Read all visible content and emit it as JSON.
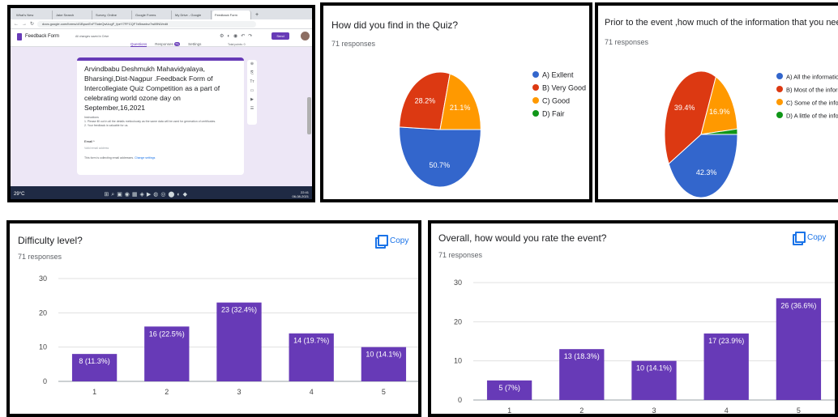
{
  "screenshot": {
    "tabs": [
      "What's New",
      "Jake Search",
      "Survey, Online",
      "Google Forms",
      "My Drive - Google",
      "Feedback Form"
    ],
    "url": "docs.google.com/forms/d/1BpunEvFTkdeQwUugF_fpeY7FFCQF7xBwwtvz7wiI9N0/edit",
    "form_name": "Feedback Form",
    "saved_note": "All changes saved in Drive",
    "send_label": "Send",
    "form_tabs": [
      "Questions",
      "Responses",
      "Settings"
    ],
    "responses_badge": "71",
    "total_points": "Total points: 0",
    "form_title": "Arvindbabu Deshmukh Mahavidyalaya, Bharsingi,Dist-Nagpur .Feedback Form of Intercollegiate Quiz Competition as a part of celebrating world ozone day on September,16,2021",
    "instructions_head": "Instructions",
    "instructions_1": "1. Please fill out in all the details meticulously as the same data will be used for generation of certificates.",
    "instructions_2": "2. Your feedback is valuable for us.",
    "email_label": "Email *",
    "email_validation": "Valid email address",
    "collect_note": "This form is collecting email addresses.",
    "change_settings": "Change settings",
    "weather": "29°C",
    "time": "22:41",
    "date": "06-08-2021"
  },
  "copy_label": "Copy",
  "colors": {
    "blue": "#3366cc",
    "red": "#dc3912",
    "orange": "#ff9900",
    "green": "#109618",
    "purple": "#673ab7"
  },
  "chart_data": [
    {
      "type": "pie",
      "title": "How did you find in the Quiz?",
      "subtitle": "71 responses",
      "legend_position": "right",
      "slices": [
        {
          "label": "A) Exllent",
          "percent": 50.7,
          "color": "#3366cc"
        },
        {
          "label": "B) Very Good",
          "percent": 28.2,
          "color": "#dc3912"
        },
        {
          "label": "C) Good",
          "percent": 21.1,
          "color": "#ff9900"
        },
        {
          "label": "D) Fair",
          "percent": 0,
          "color": "#109618"
        }
      ]
    },
    {
      "type": "pie",
      "title": "Prior to the event ,how much of the information that you needed did you get?",
      "subtitle": "71 responses",
      "legend_position": "right",
      "slices": [
        {
          "label": "A) All the information",
          "percent": 42.3,
          "color": "#3366cc"
        },
        {
          "label": "B) Most of the information",
          "percent": 39.4,
          "color": "#dc3912"
        },
        {
          "label": "C) Some of the information",
          "percent": 16.9,
          "color": "#ff9900"
        },
        {
          "label": "D) A little of the information",
          "percent": 1.4,
          "color": "#109618"
        }
      ]
    },
    {
      "type": "bar",
      "title": "Difficulty level?",
      "subtitle": "71 responses",
      "categories": [
        "1",
        "2",
        "3",
        "4",
        "5"
      ],
      "values": [
        8,
        16,
        23,
        14,
        10
      ],
      "labels": [
        "8 (11.3%)",
        "16 (22.5%)",
        "23 (32.4%)",
        "14 (19.7%)",
        "10 (14.1%)"
      ],
      "yticks": [
        0,
        10,
        20,
        30
      ],
      "ylim": [
        0,
        30
      ],
      "grid": true,
      "color": "#673ab7"
    },
    {
      "type": "bar",
      "title": "Overall, how would you rate the event?",
      "subtitle": "71 responses",
      "categories": [
        "1",
        "2",
        "3",
        "4",
        "5"
      ],
      "values": [
        5,
        13,
        10,
        17,
        26
      ],
      "labels": [
        "5 (7%)",
        "13 (18.3%)",
        "10 (14.1%)",
        "17 (23.9%)",
        "26 (36.6%)"
      ],
      "yticks": [
        0,
        10,
        20,
        30
      ],
      "ylim": [
        0,
        30
      ],
      "grid": true,
      "color": "#673ab7"
    }
  ]
}
